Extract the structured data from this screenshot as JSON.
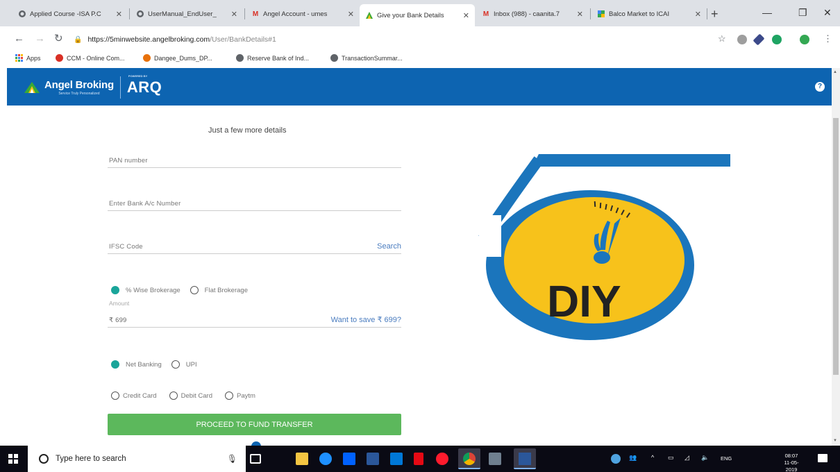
{
  "browser": {
    "tabs": [
      {
        "label": "Applied Course -ISA P.C",
        "icon": "globe-icon"
      },
      {
        "label": "UserManual_EndUser_",
        "icon": "globe-icon"
      },
      {
        "label": "Angel Account - umes",
        "icon": "gmail-icon"
      },
      {
        "label": "Give your Bank Details",
        "icon": "angel-icon",
        "active": true
      },
      {
        "label": "Inbox (988) - caanita.7",
        "icon": "gmail-icon"
      },
      {
        "label": "Balco Market to ICAI",
        "icon": "maps-icon"
      }
    ],
    "url_host": "https://5minwebsite.angelbroking.com",
    "url_path": "/User/BankDetails#1",
    "bookmarks": [
      {
        "label": "Apps",
        "color": "#4285f4"
      },
      {
        "label": "CCM - Online Com...",
        "color": "#d93025"
      },
      {
        "label": "Dangee_Dums_DP...",
        "color": "#e8710a"
      },
      {
        "label": "Reserve Bank of Ind...",
        "color": "#5f6368"
      },
      {
        "label": "TransactionSummar...",
        "color": "#5f6368"
      }
    ]
  },
  "header": {
    "brand": "Angel Broking",
    "tagline": "Service Truly Personalized",
    "arq_prefix": "POWERED BY",
    "arq": "ARQ",
    "help": "?"
  },
  "form": {
    "title": "Just a few more details",
    "pan_label": "PAN number",
    "bank_label": "Enter Bank A/c Number",
    "ifsc_label": "IFSC Code",
    "ifsc_search": "Search",
    "brokerage_options": [
      "% Wise Brokerage",
      "Flat Brokerage"
    ],
    "amount_label": "Amount",
    "amount_value": "₹ 699",
    "save_link": "Want to save ₹ 699?",
    "payment_row1": [
      "Net Banking",
      "UPI"
    ],
    "payment_row2": [
      "Credit Card",
      "Debit Card",
      "Paytm"
    ],
    "proceed": "PROCEED TO FUND TRANSFER"
  },
  "hero": {
    "text": "DIY",
    "blue": "#1b75bc",
    "yellow": "#f7c21b"
  },
  "taskbar": {
    "search_placeholder": "Type here to search",
    "lang": "ENG",
    "time": "08:07",
    "date": "11-05-2019"
  },
  "colors": {
    "header_blue": "#0d64b1",
    "radio_on": "#1aa59a",
    "button_green": "#5cb85c"
  }
}
